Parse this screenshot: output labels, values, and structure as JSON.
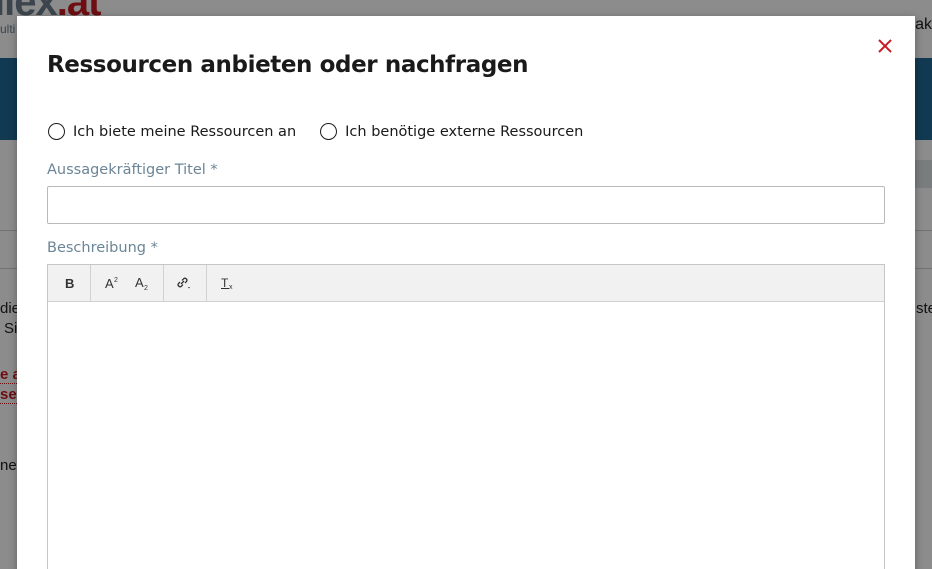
{
  "background": {
    "logo_main": "ilex",
    "logo_accent": ".at",
    "logo_sub": "ulti",
    "nav_right": "tak",
    "text_fragments": [
      "die",
      "Si",
      "e a",
      "se",
      "ne",
      "ste"
    ]
  },
  "modal": {
    "title": "Ressourcen anbieten oder nachfragen",
    "close_icon": "close-icon",
    "radio_options": [
      {
        "label": "Ich biete meine Ressourcen an",
        "checked": false
      },
      {
        "label": "Ich benötige externe Ressourcen",
        "checked": false
      }
    ],
    "title_field": {
      "label": "Aussagekräftiger Titel *",
      "value": "",
      "placeholder": ""
    },
    "description_field": {
      "label": "Beschreibung *",
      "value": ""
    },
    "toolbar": [
      {
        "name": "bold",
        "icon": "bold-icon"
      },
      {
        "name": "superscript",
        "icon": "superscript-icon"
      },
      {
        "name": "subscript",
        "icon": "subscript-icon"
      },
      {
        "name": "link",
        "icon": "link-icon"
      },
      {
        "name": "clear-format",
        "icon": "clear-format-icon"
      }
    ]
  },
  "colors": {
    "accent_red": "#c81b24",
    "label_gray_blue": "#6b8596",
    "band_blue": "#1f6b95"
  }
}
